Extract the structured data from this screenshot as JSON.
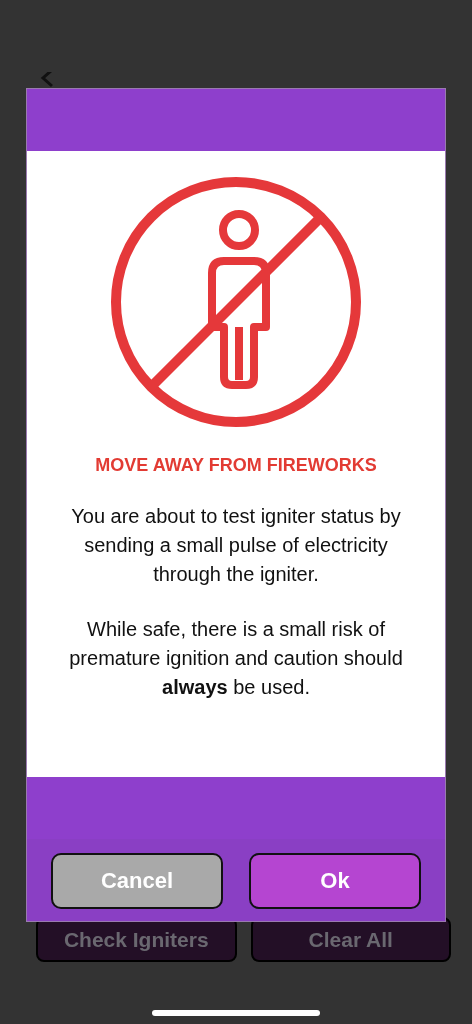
{
  "background": {
    "buttons": [
      {
        "label": "Check Igniters"
      },
      {
        "label": "Clear All"
      }
    ]
  },
  "dialog": {
    "title": "MOVE AWAY FROM FIREWORKS",
    "paragraphs": [
      "You are about to test igniter status by sending a small pulse of electricity through the igniter.",
      "While safe, there is a small risk of premature ignition and caution should **always** be used."
    ],
    "buttons": [
      {
        "label": "Cancel",
        "kind": "secondary"
      },
      {
        "label": "Ok",
        "kind": "primary"
      }
    ]
  }
}
